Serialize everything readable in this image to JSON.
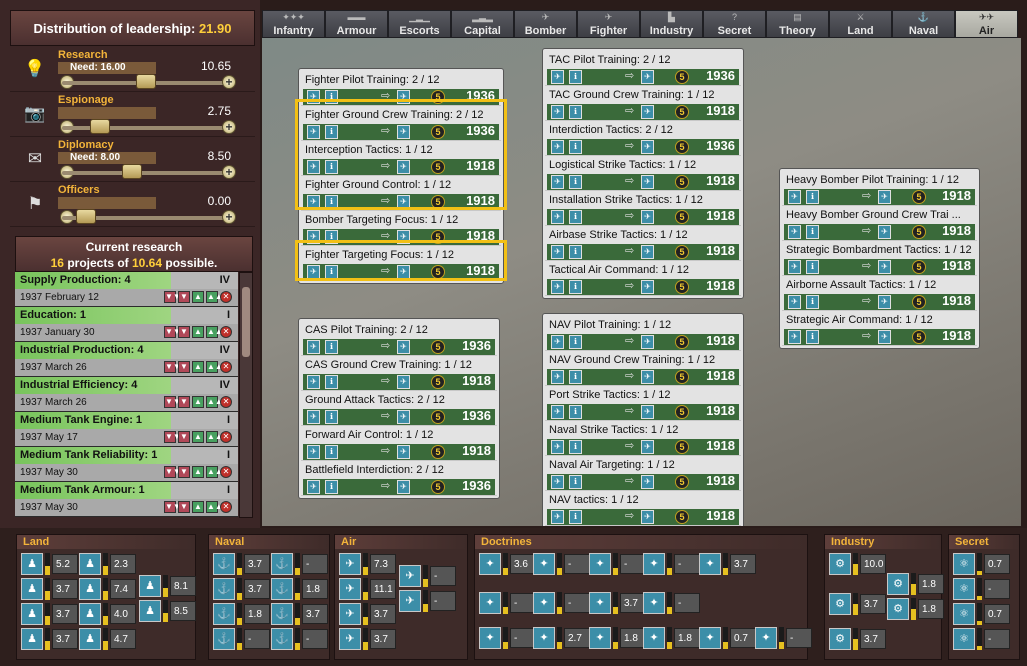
{
  "leadership": {
    "title": "Distribution of leadership:",
    "value": "21.90",
    "rows": [
      {
        "name": "Research",
        "need": "Need: 16.00",
        "value": "10.65",
        "icon": "lightbulb-icon"
      },
      {
        "name": "Espionage",
        "need": "",
        "value": "2.75",
        "icon": "camera-icon"
      },
      {
        "name": "Diplomacy",
        "need": "Need: 8.00",
        "value": "8.50",
        "icon": "envelope-icon"
      },
      {
        "name": "Officers",
        "need": "",
        "value": "0.00",
        "icon": "flag-icon"
      }
    ]
  },
  "current_research": {
    "title": "Current research",
    "count": "16",
    "text_mid": "projects of",
    "possible": "10.64",
    "text_end": "possible.",
    "items": [
      {
        "name": "Supply Production: 4",
        "date": "1937 February 12",
        "level": "IV"
      },
      {
        "name": "Education: 1",
        "date": "1937 January 30",
        "level": "I"
      },
      {
        "name": "Industrial Production: 4",
        "date": "1937 March 26",
        "level": "IV"
      },
      {
        "name": "Industrial Efficiency: 4",
        "date": "1937 March 26",
        "level": "IV"
      },
      {
        "name": "Medium Tank Engine: 1",
        "date": "1937 May 17",
        "level": "I"
      },
      {
        "name": "Medium Tank Reliability: 1",
        "date": "1937 May 30",
        "level": "I"
      },
      {
        "name": "Medium Tank Armour: 1",
        "date": "1937 May 30",
        "level": "I"
      }
    ]
  },
  "tabs": [
    "Infantry",
    "Armour",
    "Escorts",
    "Capital",
    "Bomber",
    "Fighter",
    "Industry",
    "Secret",
    "Theory",
    "Land",
    "Naval",
    "Air"
  ],
  "groups": {
    "fighter": [
      {
        "name": "Fighter Pilot Training: 2 / 12",
        "year": "1936"
      },
      {
        "name": "Fighter Ground Crew Training: 2 / 12",
        "year": "1936"
      },
      {
        "name": "Interception Tactics: 1 / 12",
        "year": "1918"
      },
      {
        "name": "Fighter Ground Control: 1 / 12",
        "year": "1918"
      },
      {
        "name": "Bomber Targeting Focus: 1 / 12",
        "year": "1918"
      },
      {
        "name": "Fighter Targeting Focus: 1 / 12",
        "year": "1918"
      }
    ],
    "cas": [
      {
        "name": "CAS Pilot Training: 2 / 12",
        "year": "1936"
      },
      {
        "name": "CAS Ground Crew Training: 1 / 12",
        "year": "1918"
      },
      {
        "name": "Ground Attack Tactics: 2 / 12",
        "year": "1936"
      },
      {
        "name": "Forward Air Control: 1 / 12",
        "year": "1918"
      },
      {
        "name": "Battlefield Interdiction: 2 / 12",
        "year": "1936"
      }
    ],
    "tac": [
      {
        "name": "TAC Pilot Training: 2 / 12",
        "year": "1936"
      },
      {
        "name": "TAC Ground Crew Training: 1 / 12",
        "year": "1918"
      },
      {
        "name": "Interdiction Tactics: 2 / 12",
        "year": "1936"
      },
      {
        "name": "Logistical Strike Tactics: 1 / 12",
        "year": "1918"
      },
      {
        "name": "Installation Strike Tactics: 1 / 12",
        "year": "1918"
      },
      {
        "name": "Airbase Strike Tactics: 1 / 12",
        "year": "1918"
      },
      {
        "name": "Tactical Air Command: 1 / 12",
        "year": "1918"
      }
    ],
    "nav": [
      {
        "name": "NAV Pilot Training: 1 / 12",
        "year": "1918"
      },
      {
        "name": "NAV Ground Crew Training: 1 / 12",
        "year": "1918"
      },
      {
        "name": "Port Strike Tactics: 1 / 12",
        "year": "1918"
      },
      {
        "name": "Naval Strike Tactics: 1 / 12",
        "year": "1918"
      },
      {
        "name": "Naval Air Targeting: 1 / 12",
        "year": "1918"
      },
      {
        "name": "NAV tactics: 1 / 12",
        "year": "1918"
      }
    ],
    "heavy": [
      {
        "name": "Heavy Bomber Pilot Training: 1 / 12",
        "year": "1918"
      },
      {
        "name": "Heavy Bomber Ground Crew Trai ...",
        "year": "1918"
      },
      {
        "name": "Strategic Bombardment Tactics: 1 / 12",
        "year": "1918"
      },
      {
        "name": "Airborne Assault Tactics: 1 / 12",
        "year": "1918"
      },
      {
        "name": "Strategic Air Command: 1 / 12",
        "year": "1918"
      }
    ]
  },
  "coin_value": "5",
  "bottom": {
    "land": {
      "title": "Land",
      "values": [
        "5.2",
        "2.3",
        "3.7",
        "7.4",
        "3.7",
        "4.0",
        "3.7",
        "4.7",
        "8.1",
        "8.5"
      ]
    },
    "naval": {
      "title": "Naval",
      "values": [
        "3.7",
        "-",
        "3.7",
        "1.8",
        "1.8",
        "3.7",
        "-",
        "-"
      ]
    },
    "air": {
      "title": "Air",
      "values": [
        "7.3",
        "11.1",
        "3.7",
        "3.7",
        "-",
        "-"
      ]
    },
    "doctrines": {
      "title": "Doctrines",
      "values": [
        "3.6",
        "-",
        "-",
        "-",
        "3.7",
        "-",
        "-",
        "3.7",
        "-",
        "-",
        "2.7",
        "1.8",
        "1.8",
        "0.7",
        "-"
      ]
    },
    "industry": {
      "title": "Industry",
      "values": [
        "10.0",
        "3.7",
        "1.8",
        "1.8",
        "3.7"
      ]
    },
    "secret": {
      "title": "Secret",
      "values": [
        "0.7",
        "-",
        "0.7",
        "-"
      ]
    }
  }
}
